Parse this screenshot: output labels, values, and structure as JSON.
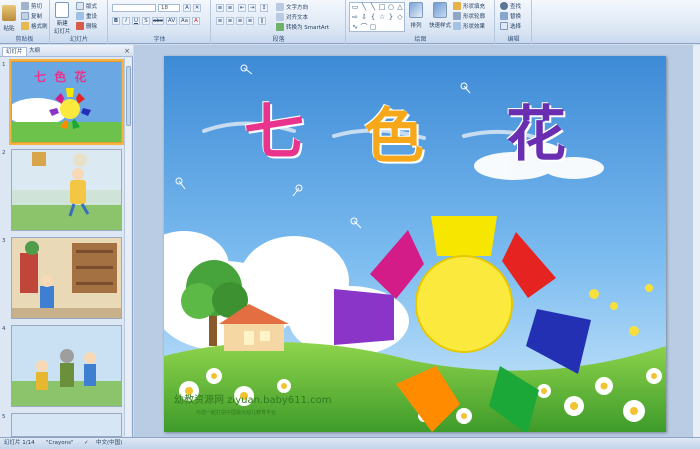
{
  "ribbon": {
    "clipboard": {
      "label": "剪贴板",
      "paste": "粘贴",
      "cut": "剪切",
      "copy": "复制",
      "format_painter": "格式刷"
    },
    "slides": {
      "label": "幻灯片",
      "new_slide": "新建",
      "new_slide_sub": "幻灯片",
      "layout": "版式",
      "reset": "重设",
      "delete": "删除"
    },
    "font": {
      "label": "字体",
      "font_name": "",
      "font_size": "18",
      "bold": "B",
      "italic": "I",
      "underline": "U",
      "shadow": "S",
      "strike": "abc",
      "spacing": "AV",
      "case": "Aa",
      "color": "A"
    },
    "paragraph": {
      "label": "段落",
      "text_direction": "文字方向",
      "align_text": "对齐文本",
      "convert_smartart": "转换为 SmartArt"
    },
    "drawing": {
      "label": "绘图",
      "arrange": "排列",
      "quick_styles": "快速样式",
      "shape_fill": "形状填充",
      "shape_outline": "形状轮廓",
      "shape_effects": "形状效果"
    },
    "editing": {
      "label": "编辑",
      "find": "查找",
      "replace": "替换",
      "select": "选择"
    },
    "colors": {
      "ribbon_top": "#f4f8fd",
      "ribbon_bottom": "#c9d9ee",
      "accent": "#1e395b"
    }
  },
  "left_pane": {
    "tabs": [
      {
        "label": "幻灯片"
      },
      {
        "label": "大纲"
      }
    ],
    "close": "×",
    "thumbnails": [
      {
        "num": "1",
        "title": "七 色 花",
        "selected": true
      },
      {
        "num": "2",
        "title": ""
      },
      {
        "num": "3",
        "title": ""
      },
      {
        "num": "4",
        "title": ""
      },
      {
        "num": "5",
        "title": ""
      }
    ]
  },
  "slide": {
    "title_chars": [
      "七",
      "色",
      "花"
    ],
    "title_colors": [
      "#e8348c",
      "#f6a81a",
      "#6a2fb1"
    ],
    "petal_colors": [
      "#f7e600",
      "#e52421",
      "#2330b4",
      "#1ca838",
      "#ff8c00",
      "#8a35c8",
      "#d41c88"
    ],
    "center_color": "#fbea3d",
    "watermark_main": "幼教资源网 ziyuan.baby611.com",
    "watermark_sub": "与您一起打造中国最大幼儿教育平台"
  },
  "statusbar": {
    "slide_info": "幻灯片 1/14",
    "theme": "\"Crayons\"",
    "language": "中文(中国)"
  }
}
